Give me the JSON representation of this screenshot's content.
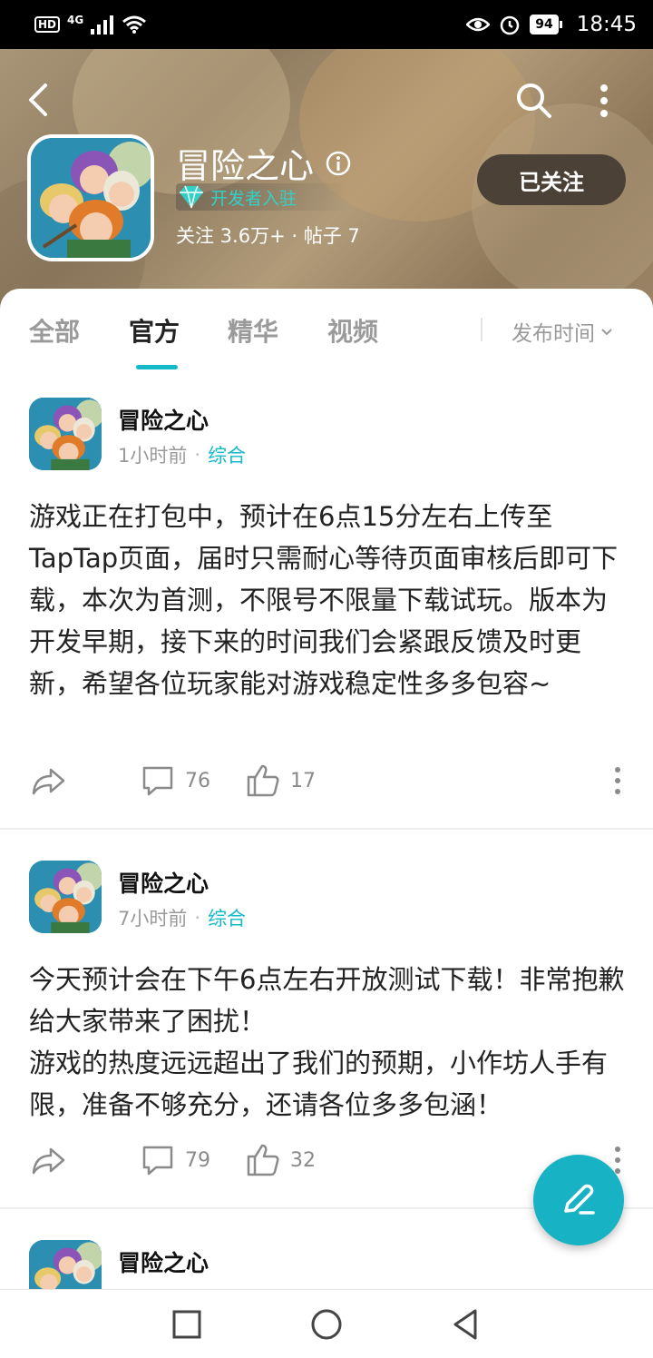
{
  "status_bar": {
    "hd_label": "HD",
    "network_label": "4G",
    "battery_level": "94",
    "time": "18:45"
  },
  "header": {
    "app_name": "冒险之心",
    "developer_badge": "开发者入驻",
    "stats": "关注 3.6万+ · 帖子 7",
    "follow_button": "已关注"
  },
  "tabs": {
    "items": [
      "全部",
      "官方",
      "精华",
      "视频"
    ],
    "active": "官方",
    "sort_label": "发布时间"
  },
  "posts": [
    {
      "author": "冒险之心",
      "time": "1小时前",
      "category": "综合",
      "body": "游戏正在打包中，预计在6点15分左右上传至TapTap页面，届时只需耐心等待页面审核后即可下载，本次为首测，不限号不限量下载试玩。版本为开发早期，接下来的时间我们会紧跟反馈及时更新，希望各位玩家能对游戏稳定性多多包容~",
      "comments": "76",
      "likes": "17"
    },
    {
      "author": "冒险之心",
      "time": "7小时前",
      "category": "综合",
      "body": "今天预计会在下午6点左右开放测试下载！非常抱歉给大家带来了困扰！\n游戏的热度远远超出了我们的预期，小作坊人手有限，准备不够充分，还请各位多多包涵！",
      "comments": "79",
      "likes": "32"
    },
    {
      "author": "冒险之心"
    }
  ],
  "colors": {
    "accent": "#14b9c8",
    "follow_button_bg": "#4b4136",
    "header_bg": "#9b8466"
  },
  "icons": [
    "back-icon",
    "search-icon",
    "more-icon",
    "info-icon",
    "diamond-icon",
    "share-icon",
    "comment-icon",
    "like-icon",
    "edit-icon",
    "nav-square-icon",
    "nav-circle-icon",
    "nav-triangle-icon"
  ]
}
